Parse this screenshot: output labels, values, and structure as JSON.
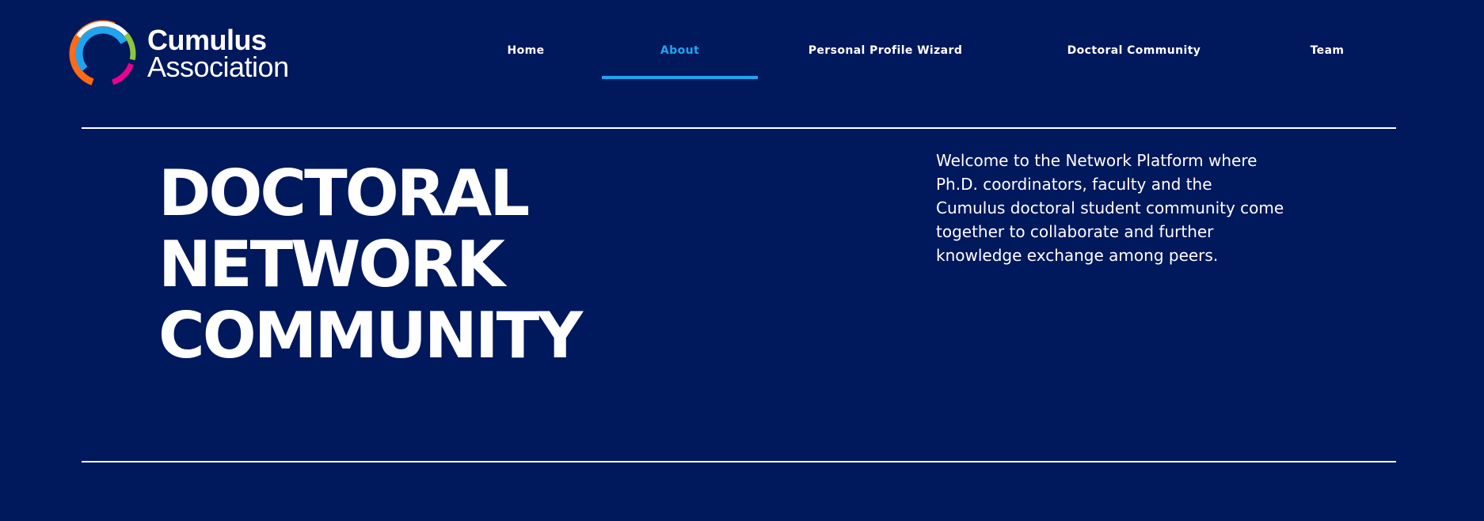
{
  "brand": {
    "name_line1": "Cumulus",
    "name_line2": "Association",
    "logo_icon": "cumulus-c-logo-icon",
    "logo_colors": [
      "#ff6a13",
      "#1ea5f2",
      "#8cc63f",
      "#ec008c",
      "#ffffff"
    ]
  },
  "nav": {
    "items": [
      {
        "label": "Home",
        "active": false
      },
      {
        "label": "About",
        "active": true
      },
      {
        "label": "Personal Profile Wizard",
        "active": false
      },
      {
        "label": "Doctoral Community",
        "active": false
      },
      {
        "label": "Team",
        "active": false
      }
    ]
  },
  "hero": {
    "title_line1": "DOCTORAL",
    "title_line2": "NETWORK",
    "title_line3": "COMMUNITY",
    "intro": "Welcome to the Network Platform where Ph.D. coordinators, faculty and the Cumulus doctoral student community come together to collaborate and further knowledge exchange among peers."
  },
  "colors": {
    "background": "#00185c",
    "accent": "#1ea5f2",
    "text": "#ffffff"
  }
}
